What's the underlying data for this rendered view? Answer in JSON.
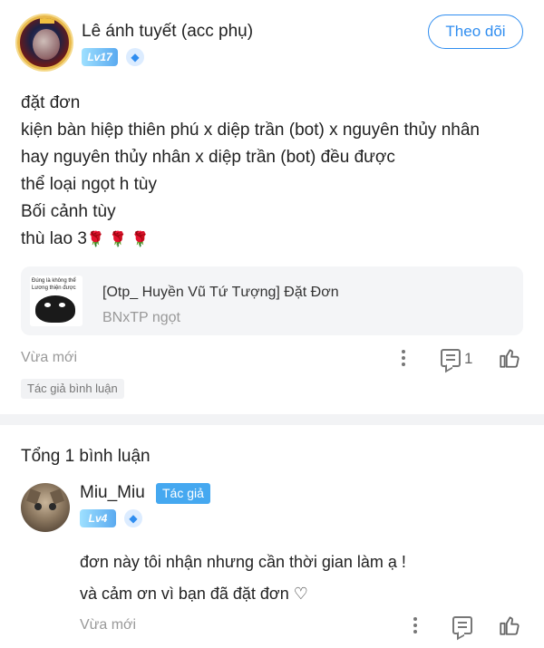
{
  "post": {
    "author_name": "Lê ánh tuyết (acc phụ)",
    "author_level": "Lv17",
    "follow_label": "Theo dõi",
    "body_lines": [
      "đặt đơn",
      "kiện bàn hiệp thiên phú x diệp trần (bot) x nguyên thủy nhân",
      "hay nguyên thủy nhân x diệp trần (bot) đều được",
      "thể loại ngọt h tùy",
      "Bối cảnh tùy",
      "thù lao 3"
    ],
    "rose_emoji": "🌹 🌹 🌹",
    "linked_card": {
      "title": "[Otp_ Huyền Vũ Tứ Tượng] Đặt Đơn",
      "subtitle": "BNxTP ngọt",
      "thumb_text_1": "Đúng là không thể",
      "thumb_text_2": "Lương thiện được"
    },
    "time": "Vừa mới",
    "comment_count": "1",
    "author_comment_tag": "Tác giả bình luận"
  },
  "comments": {
    "header": "Tổng 1 bình luận",
    "items": [
      {
        "user": "Miu_Miu",
        "tag": "Tác giả",
        "level": "Lv4",
        "text_lines": [
          "đơn này tôi nhận nhưng cần thời gian làm ạ !",
          "và cảm ơn vì bạn đã đặt đơn ♡"
        ],
        "time": "Vừa mới"
      }
    ]
  },
  "colors": {
    "accent": "#2f8df0",
    "author_tag_bg": "#45a8f0",
    "muted_text": "#999999",
    "divider": "#f2f3f5"
  },
  "icons": [
    "more-icon",
    "comment-icon",
    "like-icon",
    "verify-icon"
  ]
}
